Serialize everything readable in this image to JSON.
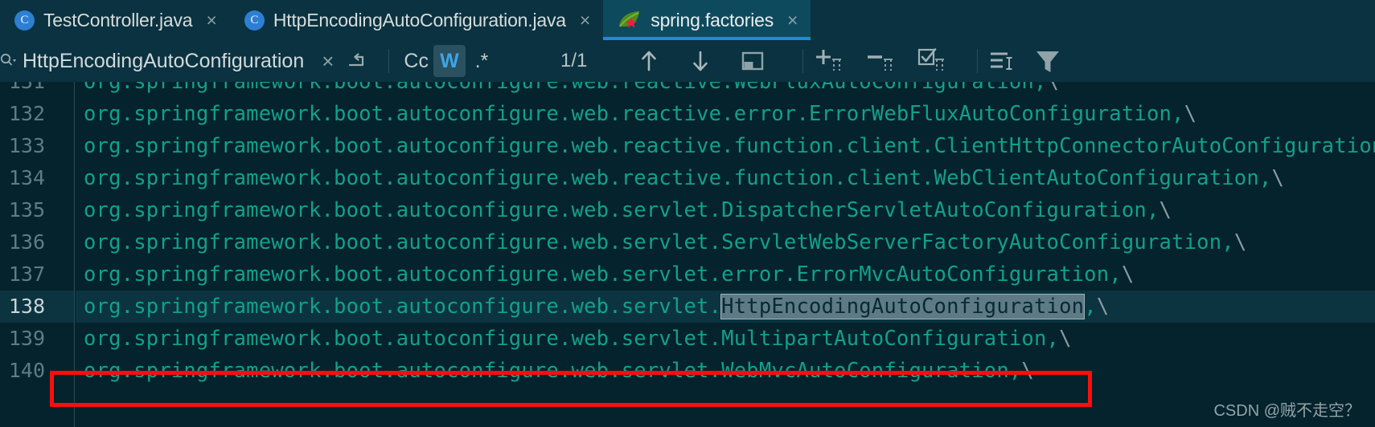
{
  "window": {
    "background": "#04232C",
    "accent": "#1E88E5",
    "code_color": "#12A08C",
    "annotation_color": "#FF0D0D"
  },
  "tabs": [
    {
      "label": "TestController.java",
      "icon": "java-class-icon",
      "active": false,
      "close_label": "×"
    },
    {
      "label": "HttpEncodingAutoConfiguration.java",
      "icon": "java-class-icon",
      "active": false,
      "close_label": "×"
    },
    {
      "label": "spring.factories",
      "icon": "spring-leaf-icon",
      "active": true,
      "close_label": "×"
    }
  ],
  "search": {
    "value": "HttpEncodingAutoConfiguration",
    "placeholder": "Search",
    "clear_label": "×",
    "match_count": "1/1",
    "options": [
      {
        "name": "match-case-toggle",
        "label": "Cc",
        "active": false
      },
      {
        "name": "words-toggle",
        "label": "W",
        "active": true
      },
      {
        "name": "regex-toggle",
        "label": ".*",
        "active": false
      }
    ],
    "buttons": [
      {
        "name": "previous-occurrence-button",
        "icon": "arrow-up-icon"
      },
      {
        "name": "next-occurrence-button",
        "icon": "arrow-down-icon"
      },
      {
        "name": "select-all-occurrences-button",
        "icon": "window-icon"
      },
      {
        "name": "add-line-button",
        "icon": "plus-column-icon"
      },
      {
        "name": "remove-line-button",
        "icon": "minus-column-icon"
      },
      {
        "name": "select-lines-button",
        "icon": "checkbox-column-icon"
      },
      {
        "name": "format-button",
        "icon": "indent-list-icon"
      },
      {
        "name": "filter-button",
        "icon": "filter-icon"
      }
    ]
  },
  "editor": {
    "lines": [
      {
        "number": "131",
        "clipped_top": true,
        "highlighted": false,
        "segments": [
          {
            "text": "org.springframework.boot.autoconfigure.web.reactive.WebFluxAutoConfiguration,",
            "type": "plain"
          },
          {
            "text": "\\",
            "type": "cont"
          }
        ]
      },
      {
        "number": "132",
        "clipped_top": false,
        "highlighted": false,
        "segments": [
          {
            "text": "org.springframework.boot.autoconfigure.web.reactive.error.ErrorWebFluxAutoConfiguration,",
            "type": "plain"
          },
          {
            "text": "\\",
            "type": "cont"
          }
        ]
      },
      {
        "number": "133",
        "clipped_top": false,
        "highlighted": false,
        "segments": [
          {
            "text": "org.springframework.boot.autoconfigure.web.reactive.function.client.ClientHttpConnectorAutoConfiguration,",
            "type": "plain"
          },
          {
            "text": "\\",
            "type": "cont"
          }
        ]
      },
      {
        "number": "134",
        "clipped_top": false,
        "highlighted": false,
        "segments": [
          {
            "text": "org.springframework.boot.autoconfigure.web.reactive.function.client.WebClientAutoConfiguration,",
            "type": "plain"
          },
          {
            "text": "\\",
            "type": "cont"
          }
        ]
      },
      {
        "number": "135",
        "clipped_top": false,
        "highlighted": false,
        "segments": [
          {
            "text": "org.springframework.boot.autoconfigure.web.servlet.DispatcherServletAutoConfiguration,",
            "type": "plain"
          },
          {
            "text": "\\",
            "type": "cont"
          }
        ]
      },
      {
        "number": "136",
        "clipped_top": false,
        "highlighted": false,
        "segments": [
          {
            "text": "org.springframework.boot.autoconfigure.web.servlet.ServletWebServerFactoryAutoConfiguration,",
            "type": "plain"
          },
          {
            "text": "\\",
            "type": "cont"
          }
        ]
      },
      {
        "number": "137",
        "clipped_top": false,
        "highlighted": false,
        "segments": [
          {
            "text": "org.springframework.boot.autoconfigure.web.servlet.error.ErrorMvcAutoConfiguration,",
            "type": "plain"
          },
          {
            "text": "\\",
            "type": "cont"
          }
        ]
      },
      {
        "number": "138",
        "clipped_top": false,
        "highlighted": true,
        "segments": [
          {
            "text": "org.springframework.boot.autoconfigure.web.servlet.",
            "type": "plain"
          },
          {
            "text": "HttpEncodingAutoConfiguration",
            "type": "match"
          },
          {
            "text": ",",
            "type": "plain"
          },
          {
            "text": "\\",
            "type": "cont"
          }
        ]
      },
      {
        "number": "139",
        "clipped_top": false,
        "highlighted": false,
        "segments": [
          {
            "text": "org.springframework.boot.autoconfigure.web.servlet.MultipartAutoConfiguration,",
            "type": "plain"
          },
          {
            "text": "\\",
            "type": "cont"
          }
        ]
      },
      {
        "number": "140",
        "clipped_top": false,
        "highlighted": false,
        "segments": [
          {
            "text": "org.springframework.boot.autoconfigure.web.servlet.WebMvcAutoConfiguration,",
            "type": "plain"
          },
          {
            "text": "\\",
            "type": "cont"
          }
        ]
      }
    ]
  },
  "watermark": {
    "text": "CSDN @贼不走空？"
  }
}
